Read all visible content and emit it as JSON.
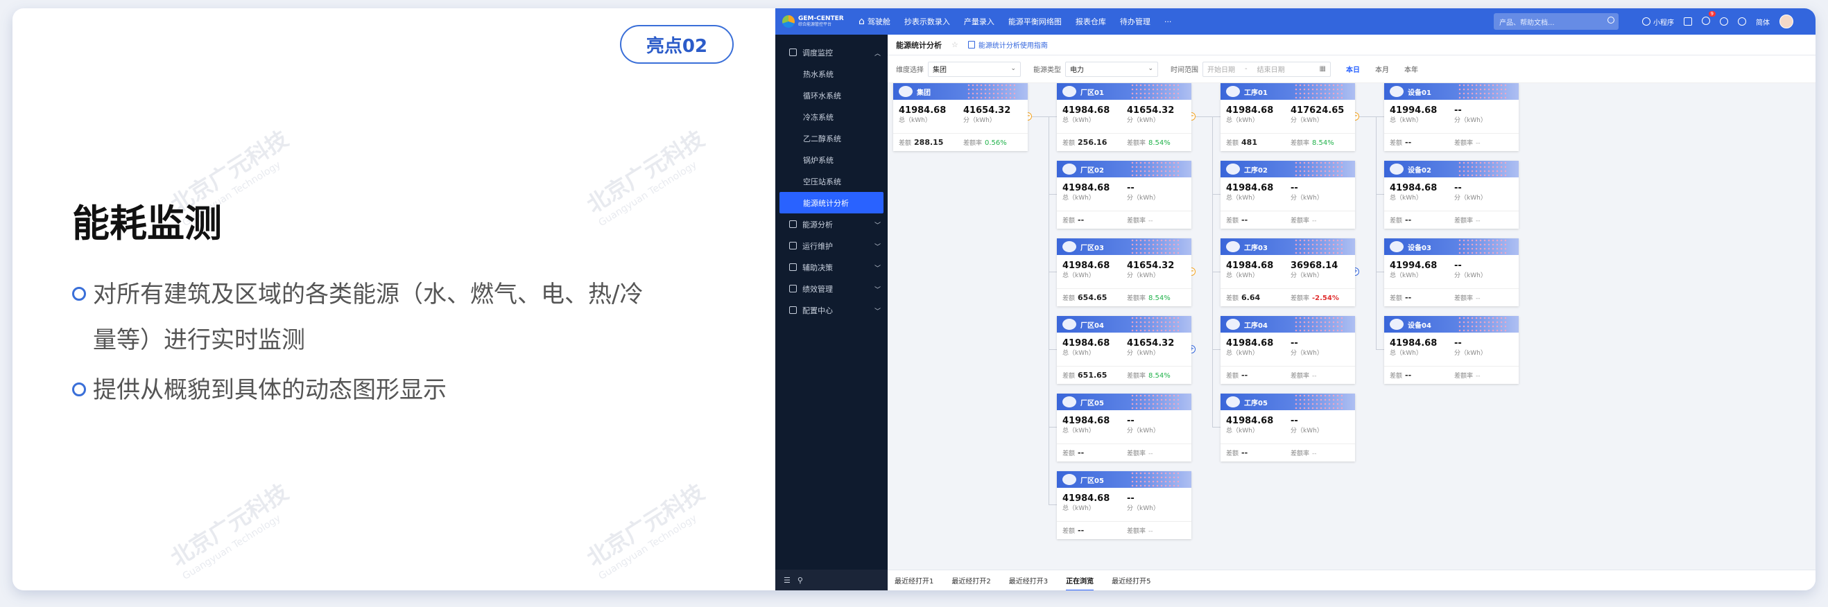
{
  "slide": {
    "badge": "亮点02",
    "title": "能耗监测",
    "bullets": [
      {
        "line1": "对所有建筑及区域的各类能源（水、燃气、电、热/冷",
        "line2": "量等）进行实时监测"
      },
      {
        "line1": "提供从概貌到具体的动态图形显示",
        "line2": ""
      }
    ],
    "watermark": {
      "cn": "北京广元科技",
      "en": "Guangyuan Technology"
    }
  },
  "app": {
    "logo": {
      "name": "GEM-CENTER",
      "sub": "综合能源管控平台"
    },
    "nav": [
      "驾驶舱",
      "抄表示数录入",
      "产量录入",
      "能源平衡网络图",
      "报表仓库",
      "待办管理",
      "···"
    ],
    "search_placeholder": "产品、帮助文档...",
    "mini_program": "小程序",
    "notif_count": "9",
    "lang": "简体",
    "sidebar": {
      "group1": "调度监控",
      "items": [
        "热水系统",
        "循环水系统",
        "冷冻系统",
        "乙二醇系统",
        "锅炉系统",
        "空压站系统",
        "能源统计分析"
      ],
      "groups": [
        "能源分析",
        "运行维护",
        "辅助决策",
        "绩效管理",
        "配置中心"
      ]
    },
    "breadcrumb": {
      "title": "能源统计分析",
      "link": "能源统计分析使用指南"
    },
    "filters": {
      "level_label": "维度选择",
      "level_value": "集团",
      "type_label": "能源类型",
      "type_value": "电力",
      "time_label": "时间范围",
      "start_placeholder": "开始日期",
      "end_placeholder": "结束日期",
      "quick": [
        "本日",
        "本月",
        "本年"
      ]
    },
    "labels": {
      "total": "总（kWh）",
      "sub": "分（kWh）",
      "diff": "差额",
      "diff_rate": "差额率"
    },
    "tabs": [
      "最近经打开1",
      "最近经打开2",
      "最近经打开3",
      "正在浏览",
      "最近经打开5"
    ],
    "nodes": [
      {
        "id": "g",
        "col": 0,
        "row": 0,
        "name": "集团",
        "total": "41984.68",
        "sub": "41654.32",
        "diff": "288.15",
        "rate": "0.56%",
        "rate_color": "g"
      },
      {
        "id": "c1",
        "col": 1,
        "row": 0,
        "name": "厂区01",
        "total": "41984.68",
        "sub": "41654.32",
        "diff": "256.16",
        "rate": "8.54%",
        "rate_color": "g"
      },
      {
        "id": "c2",
        "col": 1,
        "row": 1,
        "name": "厂区02",
        "total": "41984.68",
        "sub": "--",
        "diff": "--",
        "rate": "--",
        "rate_color": "n"
      },
      {
        "id": "c3",
        "col": 1,
        "row": 2,
        "name": "厂区03",
        "total": "41984.68",
        "sub": "41654.32",
        "diff": "654.65",
        "rate": "8.54%",
        "rate_color": "g"
      },
      {
        "id": "c4",
        "col": 1,
        "row": 3,
        "name": "厂区04",
        "total": "41984.68",
        "sub": "41654.32",
        "diff": "651.65",
        "rate": "8.54%",
        "rate_color": "g"
      },
      {
        "id": "c5",
        "col": 1,
        "row": 4,
        "name": "厂区05",
        "total": "41984.68",
        "sub": "--",
        "diff": "--",
        "rate": "--",
        "rate_color": "n"
      },
      {
        "id": "c6",
        "col": 1,
        "row": 5,
        "name": "厂区05",
        "total": "41984.68",
        "sub": "--",
        "diff": "--",
        "rate": "--",
        "rate_color": "n"
      },
      {
        "id": "p1",
        "col": 2,
        "row": 0,
        "name": "工序01",
        "total": "41984.68",
        "sub": "417624.65",
        "diff": "481",
        "rate": "8.54%",
        "rate_color": "g"
      },
      {
        "id": "p2",
        "col": 2,
        "row": 1,
        "name": "工序02",
        "total": "41984.68",
        "sub": "--",
        "diff": "--",
        "rate": "--",
        "rate_color": "n"
      },
      {
        "id": "p3",
        "col": 2,
        "row": 2,
        "name": "工序03",
        "total": "41984.68",
        "sub": "36968.14",
        "diff": "6.64",
        "rate": "-2.54%",
        "rate_color": "r"
      },
      {
        "id": "p4",
        "col": 2,
        "row": 3,
        "name": "工序04",
        "total": "41984.68",
        "sub": "--",
        "diff": "--",
        "rate": "--",
        "rate_color": "n"
      },
      {
        "id": "p5",
        "col": 2,
        "row": 4,
        "name": "工序05",
        "total": "41984.68",
        "sub": "--",
        "diff": "--",
        "rate": "--",
        "rate_color": "n"
      },
      {
        "id": "d1",
        "col": 3,
        "row": 0,
        "name": "设备01",
        "total": "41994.68",
        "sub": "--",
        "diff": "--",
        "rate": "--",
        "rate_color": "n"
      },
      {
        "id": "d2",
        "col": 3,
        "row": 1,
        "name": "设备02",
        "total": "41984.68",
        "sub": "--",
        "diff": "--",
        "rate": "--",
        "rate_color": "n"
      },
      {
        "id": "d3",
        "col": 3,
        "row": 2,
        "name": "设备03",
        "total": "41994.68",
        "sub": "--",
        "diff": "--",
        "rate": "--",
        "rate_color": "n"
      },
      {
        "id": "d4",
        "col": 3,
        "row": 3,
        "name": "设备04",
        "total": "41984.68",
        "sub": "--",
        "diff": "--",
        "rate": "--",
        "rate_color": "n"
      }
    ]
  }
}
